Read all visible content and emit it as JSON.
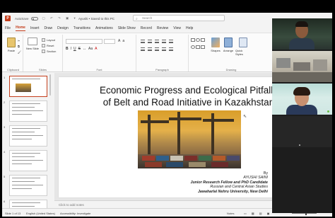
{
  "window": {
    "autosave_label": "AutoSave",
    "autosave_state": "Off",
    "doc_title": "Ayushi • Saved to this PC",
    "search_placeholder": "Search"
  },
  "tabs": [
    "File",
    "Home",
    "Insert",
    "Draw",
    "Design",
    "Transitions",
    "Animations",
    "Slide Show",
    "Record",
    "Review",
    "View",
    "Help"
  ],
  "active_tab": "Home",
  "ribbon": {
    "paste_label": "Paste",
    "new_slide_label": "New Slide",
    "layout_label": "Layout",
    "reset_label": "Reset",
    "section_label": "Section",
    "groups": {
      "clipboard": "Clipboard",
      "slides": "Slides",
      "font": "Font",
      "paragraph": "Paragraph",
      "drawing": "Drawing"
    },
    "shapes_label": "Shapes",
    "arrange_label": "Arrange",
    "quick_styles_label": "Quick Styles",
    "shape_fill_label": "Shape Fill",
    "shape_outline_label": "Shape Outline",
    "shape_effects_label": "Shape Effects"
  },
  "thumbnails": [
    {
      "num": "1",
      "title": "Economic Progress and Ecological Pitfalls",
      "selected": true
    },
    {
      "num": "2",
      "title": "Introduction",
      "selected": false
    },
    {
      "num": "3",
      "title": "Economic Ties",
      "selected": false
    },
    {
      "num": "4",
      "title": "BRI and Kazakhstan",
      "selected": false
    },
    {
      "num": "5",
      "title": "",
      "selected": false
    },
    {
      "num": "6",
      "title": "BRI and Economic Progress of Kazakhstan",
      "selected": false
    }
  ],
  "slide": {
    "title_line1": "Economic Progress and Ecological Pitfalls",
    "title_line2": "of Belt and Road Initiative in Kazakhstan",
    "by": "By",
    "author": "AYUSHI SAINI",
    "role": "Junior Research Fellow and PhD Candidate",
    "dept": "Russian and Central Asian Studies",
    "university": "Jawaharlal Nehru University, New Delhi"
  },
  "notes_placeholder": "Click to add notes",
  "status": {
    "slide_counter": "Slide 1 of 13",
    "language": "English (United States)",
    "accessibility": "Accessibility: Investigate",
    "notes_label": "Notes",
    "zoom_level": 0.55
  },
  "participants": [
    {
      "name": "participant-1"
    },
    {
      "name": "participant-2"
    },
    {
      "name": "participant-3"
    },
    {
      "name": "participant-4"
    }
  ],
  "colors": {
    "accent": "#c43e1c",
    "background": "#f3f3f3"
  }
}
